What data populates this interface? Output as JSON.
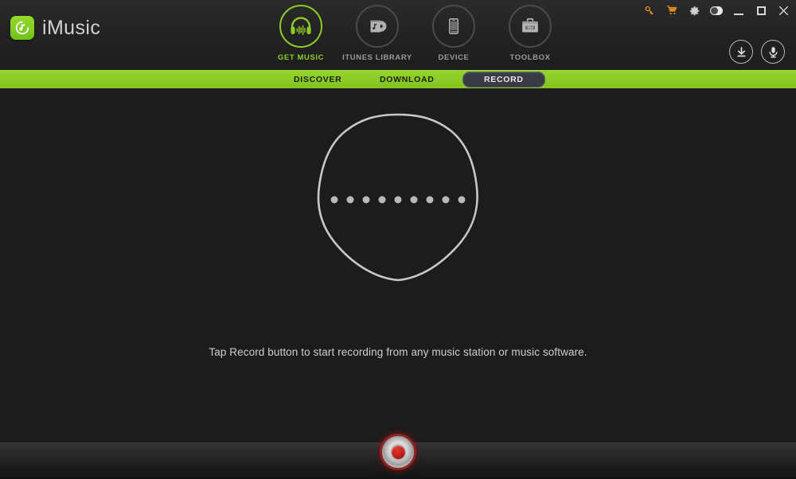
{
  "app": {
    "brand_name": "iMusic",
    "brand_icon": "music-note-logo-icon",
    "accent_green": "#8ccb28",
    "bg_dark": "#1c1c1c"
  },
  "window_controls": {
    "items": [
      {
        "name": "key-icon",
        "glyph": "⚿",
        "color": "#e8921f"
      },
      {
        "name": "cart-icon",
        "glyph": "🛒",
        "color": "#e8921f"
      },
      {
        "name": "gear-icon",
        "glyph": "⚙",
        "color": "#d8d8d8"
      },
      {
        "name": "toggle-switch",
        "glyph": "",
        "color": "#e8e8e8"
      },
      {
        "name": "minimize-button",
        "glyph": "—",
        "color": "#d8d8d8"
      },
      {
        "name": "maximize-button",
        "glyph": "□",
        "color": "#d8d8d8"
      },
      {
        "name": "close-button",
        "glyph": "✕",
        "color": "#d8d8d8"
      }
    ]
  },
  "main_nav": {
    "items": [
      {
        "label": "GET MUSIC",
        "icon": "headphones-icon",
        "active": true
      },
      {
        "label": "ITUNES LIBRARY",
        "icon": "album-disc-icon",
        "active": false
      },
      {
        "label": "DEVICE",
        "icon": "smartphone-icon",
        "active": false
      },
      {
        "label": "TOOLBOX",
        "icon": "toolbox-icon",
        "active": false
      }
    ]
  },
  "header_actions": {
    "items": [
      {
        "name": "download-button",
        "icon": "download-arrow-icon"
      },
      {
        "name": "record-mic-button",
        "icon": "microphone-icon"
      }
    ]
  },
  "sub_nav": {
    "items": [
      {
        "label": "DISCOVER",
        "active": false
      },
      {
        "label": "DOWNLOAD",
        "active": false
      },
      {
        "label": "RECORD",
        "active": true
      }
    ],
    "active_pill_bg": "#3a3a45",
    "bar_color": "#8bcb26"
  },
  "main": {
    "visualizer": {
      "shape": "rounded-pentagon",
      "stroke_color": "#c8c8c8",
      "dot_count": 9,
      "dot_color": "#b9b9b9"
    },
    "hint_text": "Tap Record button to start recording from any music station or music software."
  },
  "bottom_bar": {
    "record_button": {
      "name": "record-button",
      "ring_color": "#8d2626",
      "center_color": "#c1201a"
    }
  }
}
